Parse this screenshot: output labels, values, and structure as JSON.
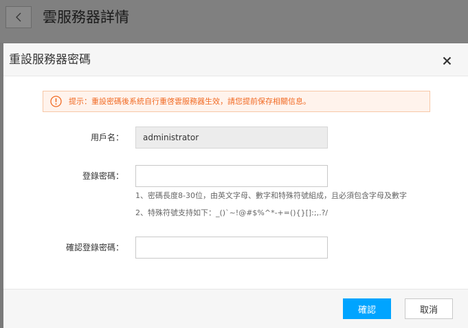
{
  "page": {
    "title": "雲服務器詳情"
  },
  "modal": {
    "title": "重設服務器密碼",
    "alert_text": "提示：重設密碼後系統自行重啓雲服務器生效，請您提前保存相關信息。",
    "form": {
      "username_label": "用戶名：",
      "username_value": "administrator",
      "password_label": "登錄密碼：",
      "password_value": "",
      "hint_1": "1、密碼長度8-30位，由英文字母、數字和特殊符號組成，且必須包含字母及數字",
      "hint_2": "2、特殊符號支持如下：_()`~!@#$%^*-+=(){}[]:;,.?/",
      "confirm_label": "確認登錄密碼：",
      "confirm_value": ""
    },
    "buttons": {
      "confirm": "確認",
      "cancel": "取消"
    }
  },
  "colors": {
    "primary": "#00a4ff",
    "alert_text": "#f16a23",
    "alert_bg": "#fff3ec",
    "alert_border": "#f7c7a6"
  },
  "icons": {
    "back": "chevron-left-icon",
    "close": "close-icon",
    "alert": "exclamation-circle-icon"
  }
}
